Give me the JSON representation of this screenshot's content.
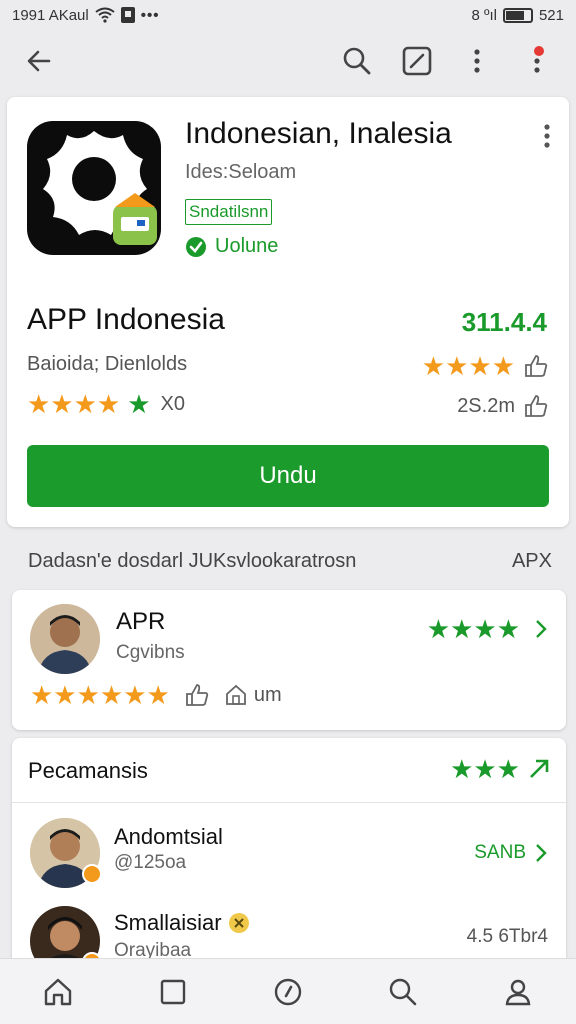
{
  "status_bar": {
    "left_text": "1991 AKaul",
    "right_text": "8 ºıl",
    "time": "521"
  },
  "app": {
    "title": "Indonesian, Inalesia",
    "developer": "Ides:Seloam",
    "tag": "Sndatilsnn",
    "verified_label": "Uolune",
    "name": "APP Indonesia",
    "version": "311.4.4",
    "category": "Baioida; Dienlolds",
    "rating_count": "X0",
    "size": "2S.2m",
    "install_label": "Undu"
  },
  "section": {
    "title": "Dadasn'e dosdarl JUKsvlookaratrosn",
    "right": "APX"
  },
  "review": {
    "title": "APR",
    "subtitle": "Cgvibns",
    "extra": "um"
  },
  "recommendations": {
    "title": "Pecamansis",
    "items": [
      {
        "title": "Andomtsial",
        "subtitle": "@125oa",
        "right": "SANB"
      },
      {
        "title": "Smallaisiar",
        "subtitle": "Orayibaa",
        "right": "4.5 6Tbr4"
      }
    ]
  },
  "colors": {
    "accent_green": "#1a9b2b",
    "star_orange": "#f39a1c"
  },
  "icons": {
    "app_bar": [
      "back-arrow-icon",
      "search-icon",
      "edit-icon",
      "more-vert-icon",
      "notification-icon"
    ],
    "bottom_nav": [
      "home-icon",
      "square-icon",
      "compass-icon",
      "search-icon",
      "profile-icon"
    ]
  }
}
